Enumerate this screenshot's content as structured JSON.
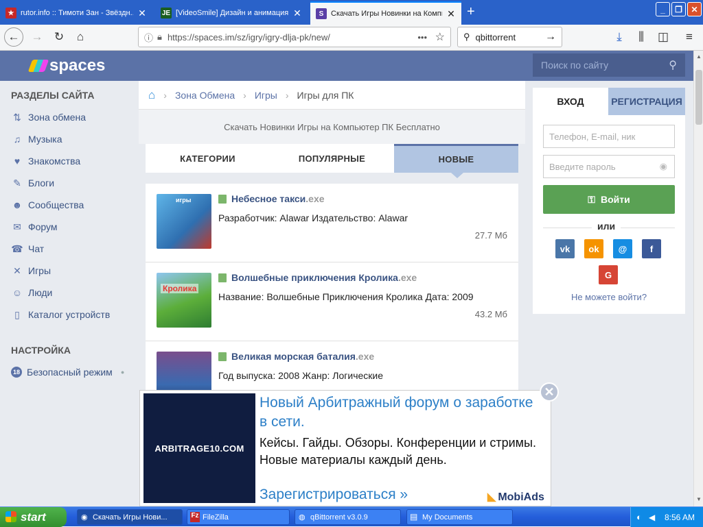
{
  "browser": {
    "tabs": [
      {
        "title": "rutor.info :: Тимоти Зан - Звёздн...",
        "icon": "star-favicon-icon",
        "color": "#c62828"
      },
      {
        "title": "[VideoSmile] Дизайн и анимация",
        "icon": "je-favicon-icon",
        "color": "#1b5e20"
      },
      {
        "title": "Скачать Игры Новинки на Компь...",
        "icon": "spaces-favicon-icon",
        "color": "#5b3fa6"
      }
    ],
    "new_tab": "+",
    "url": "https://spaces.im/sz/igry/igry-dlja-pk/new/",
    "search_value": "qbittorrent",
    "more": "•••"
  },
  "site": {
    "logo": "spaces",
    "search_placeholder": "Поиск по сайту"
  },
  "sidebar": {
    "heading": "РАЗДЕЛЫ САЙТА",
    "items": [
      {
        "label": "Зона обмена",
        "icon": "exchange-icon",
        "glyph": "⇅"
      },
      {
        "label": "Музыка",
        "icon": "music-icon",
        "glyph": "♫"
      },
      {
        "label": "Знакомства",
        "icon": "heart-icon",
        "glyph": "♥"
      },
      {
        "label": "Блоги",
        "icon": "pen-icon",
        "glyph": "✎"
      },
      {
        "label": "Сообщества",
        "icon": "group-icon",
        "glyph": "☻"
      },
      {
        "label": "Форум",
        "icon": "forum-icon",
        "glyph": "✉"
      },
      {
        "label": "Чат",
        "icon": "chat-icon",
        "glyph": "☎"
      },
      {
        "label": "Игры",
        "icon": "games-icon",
        "glyph": "✕"
      },
      {
        "label": "Люди",
        "icon": "people-icon",
        "glyph": "☺"
      },
      {
        "label": "Каталог устройств",
        "icon": "device-icon",
        "glyph": "▯"
      }
    ],
    "settings_heading": "НАСТРОЙКА",
    "safe_mode": {
      "badge": "18",
      "label": "Безопасный режим"
    }
  },
  "breadcrumb": {
    "items": [
      "Зона Обмена",
      "Игры",
      "Игры для ПК"
    ]
  },
  "subtitle": "Скачать Новинки Игры на Компьютер ПК Бесплатно",
  "tabs": [
    "КАТЕГОРИИ",
    "ПОПУЛЯРНЫЕ",
    "НОВЫЕ"
  ],
  "files": [
    {
      "name": "Небесное такси",
      "ext": ".exe",
      "desc": "Разработчик: Alawar Издательство: Alawar",
      "size": "27.7 Мб",
      "thumb_color": "#4aa0d8",
      "thumb_label": "игры"
    },
    {
      "name": "Волшебные приключения Кролика",
      "ext": ".exe",
      "desc": "Название: Волшебные Приключения Кролика Дата: 2009",
      "size": "43.2 Мб",
      "thumb_color": "#5cae3a",
      "thumb_label": "Кролика"
    },
    {
      "name": "Великая морская баталия",
      "ext": ".exe",
      "desc": "Год выпуска: 2008 Жанр: Логические",
      "size": "",
      "thumb_color": "#7a4e8c",
      "thumb_label": ""
    }
  ],
  "login": {
    "tab_login": "ВХОД",
    "tab_register": "РЕГИСТРАЦИЯ",
    "phone_placeholder": "Телефон, E-mail, ник",
    "password_placeholder": "Введите пароль",
    "button": "Войти",
    "or": "или",
    "social": [
      {
        "icon": "vk-icon",
        "glyph": "vk",
        "color": "#4a76a8"
      },
      {
        "icon": "odnoklassniki-icon",
        "glyph": "ok",
        "color": "#f59300"
      },
      {
        "icon": "mailru-icon",
        "glyph": "@",
        "color": "#168de2"
      },
      {
        "icon": "facebook-icon",
        "glyph": "f",
        "color": "#3b5998"
      },
      {
        "icon": "google-icon",
        "glyph": "G",
        "color": "#d64535"
      }
    ],
    "cant_login": "Не можете войти?"
  },
  "ad": {
    "image_text": "ARBITRAGE10.COM",
    "title": "Новый Арбитражный форум о заработке в сети.",
    "text": "Кейсы. Гайды. Обзоры. Конференции и стримы. Новые материалы каждый день.",
    "cta": "Зарегистрироваться »",
    "brand": "MobiAds"
  },
  "taskbar": {
    "start": "start",
    "items": [
      "Скачать Игры Нови...",
      "FileZilla",
      "qBittorrent v3.0.9",
      "My Documents"
    ],
    "clock": "8:56 AM"
  }
}
